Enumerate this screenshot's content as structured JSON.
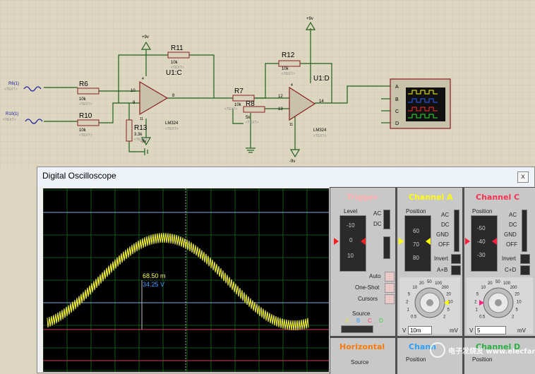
{
  "schematic": {
    "sources": [
      {
        "name": "R6(1)",
        "text": "<TEXT>"
      },
      {
        "name": "R10(1)",
        "text": "<TEXT>"
      }
    ],
    "resistors": [
      {
        "name": "R6",
        "value": "10k",
        "text": "<TEXT>"
      },
      {
        "name": "R10",
        "value": "10k",
        "text": "<TEXT>"
      },
      {
        "name": "R11",
        "value": "10k",
        "text": "<TEXT>"
      },
      {
        "name": "R13",
        "value": "3.3k",
        "text": "<TEXT>"
      },
      {
        "name": "R7",
        "value": "10k",
        "text": "<TEXT>"
      },
      {
        "name": "R8",
        "value": "5k",
        "text": "<TEXT>"
      },
      {
        "name": "R12",
        "value": "10k",
        "text": "<TEXT>"
      }
    ],
    "opamps": [
      {
        "name": "U1:C",
        "part": "LM324",
        "text": "<TEXT>",
        "pins": [
          "10",
          "9",
          "8",
          "4",
          "11"
        ]
      },
      {
        "name": "U1:D",
        "part": "LM324",
        "text": "<TEXT>",
        "pins": [
          "12",
          "13",
          "14",
          "4",
          "11"
        ]
      }
    ],
    "supplies": {
      "pos": "+9v",
      "neg": "-9v"
    },
    "scope_inputs": [
      "A",
      "B",
      "C",
      "D"
    ]
  },
  "window": {
    "title": "Digital Oscilloscope",
    "close": "x"
  },
  "screen": {
    "readout_time": "68.50 m",
    "readout_volt": "34.25 V"
  },
  "panel": {
    "trigger": {
      "title": "Trigger",
      "level_label": "Level",
      "ticks": [
        "-10",
        "0",
        "10"
      ],
      "ac": "AC",
      "dc": "DC",
      "auto": "Auto",
      "oneshot": "One-Shot",
      "cursors": "Cursors",
      "source_label": "Source",
      "sources": [
        "A",
        "B",
        "C",
        "D"
      ]
    },
    "channel_a": {
      "title": "Channel A",
      "position_label": "Position",
      "ticks": [
        "60",
        "70",
        "80"
      ],
      "modes": [
        "AC",
        "DC",
        "GND",
        "OFF"
      ],
      "invert": "Invert",
      "sum": "A+B",
      "dial": [
        "0.5",
        "1",
        "2",
        "5",
        "10",
        "20",
        "50",
        "100",
        "200",
        "20",
        "10",
        "5",
        "2"
      ],
      "unit_left": "V",
      "value": "10m",
      "unit_right": "mV"
    },
    "channel_c": {
      "title": "Channel C",
      "position_label": "Position",
      "ticks": [
        "-50",
        "-40",
        "-30"
      ],
      "modes": [
        "AC",
        "DC",
        "GND",
        "OFF"
      ],
      "invert": "Invert",
      "sum": "C+D",
      "dial": [
        "0.5",
        "1",
        "2",
        "5",
        "10",
        "20",
        "50",
        "100",
        "200",
        "20",
        "10",
        "5",
        "2"
      ],
      "unit_left": "V",
      "value": "5",
      "unit_right": "mV"
    },
    "horizontal": {
      "title": "Horizontal",
      "source_label": "Source"
    },
    "channel_b": {
      "title": "Chann",
      "position_label": "Position"
    },
    "channel_d": {
      "title": "Channel D",
      "position_label": "Position"
    }
  },
  "watermark": "电子发烧友 www.elecfans.com",
  "colors": {
    "trace": "#ffff40",
    "channel_a": "#ffff00",
    "channel_c": "#ff3050",
    "channel_b": "#2aa0ff",
    "trigger": "#ff7070",
    "horizontal": "#ff7a00"
  }
}
